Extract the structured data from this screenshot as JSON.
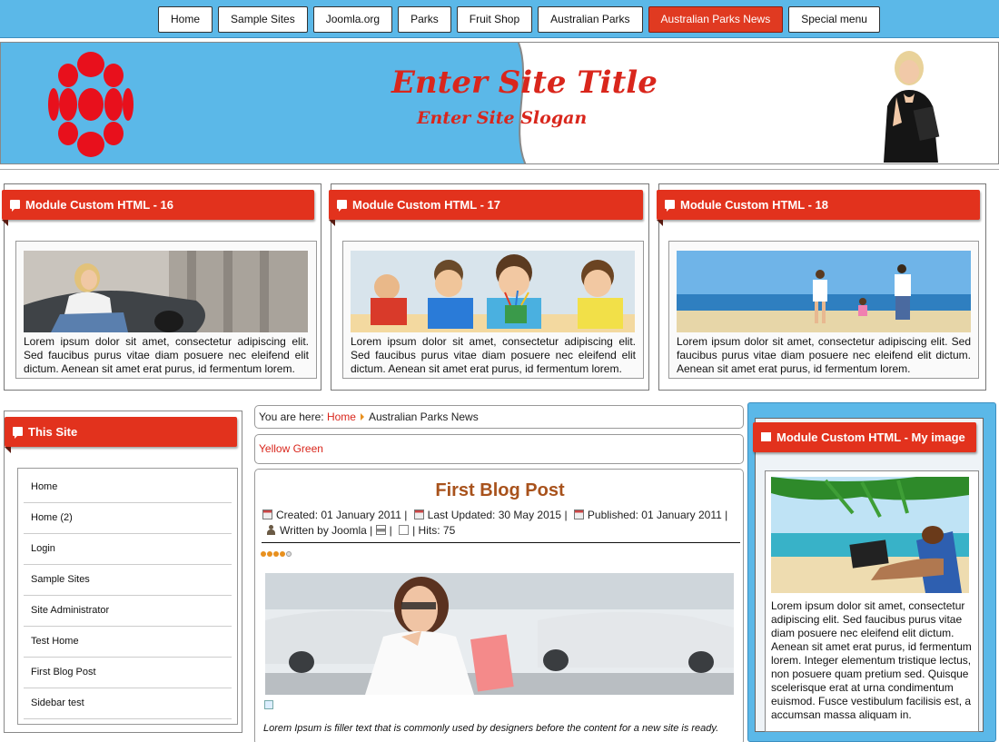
{
  "nav": {
    "items": [
      {
        "label": "Home",
        "active": false
      },
      {
        "label": "Sample Sites",
        "active": false
      },
      {
        "label": "Joomla.org",
        "active": false
      },
      {
        "label": "Parks",
        "active": false
      },
      {
        "label": "Fruit Shop",
        "active": false
      },
      {
        "label": "Australian Parks",
        "active": false
      },
      {
        "label": "Australian Parks News",
        "active": true
      },
      {
        "label": "Special menu",
        "active": false
      }
    ]
  },
  "header": {
    "title": "Enter Site Title",
    "slogan": "Enter Site Slogan"
  },
  "modules": [
    {
      "title": "Module Custom HTML - 16",
      "text": "Lorem ipsum dolor sit amet, consectetur adipiscing elit. Sed faucibus purus vitae diam posuere nec eleifend elit dictum. Aenean sit amet erat purus, id fermentum lorem.",
      "image": "woman-with-car-photo"
    },
    {
      "title": "Module Custom HTML - 17",
      "text": "Lorem ipsum dolor sit amet, consectetur adipiscing elit. Sed faucibus purus vitae diam posuere nec eleifend elit dictum. Aenean sit amet erat purus, id fermentum lorem.",
      "image": "children-classroom-photo"
    },
    {
      "title": "Module Custom HTML - 18",
      "text": "Lorem ipsum dolor sit amet, consectetur adipiscing elit. Sed faucibus purus vitae diam posuere nec eleifend elit dictum. Aenean sit amet erat purus, id fermentum lorem.",
      "image": "family-beach-photo"
    }
  ],
  "sidebar": {
    "title": "This Site",
    "links": [
      "Home",
      "Home (2)",
      "Login",
      "Sample Sites",
      "Site Administrator",
      "Test Home",
      "First Blog Post",
      "Sidebar test"
    ]
  },
  "breadcrumb": {
    "prefix": "You are here:",
    "home": "Home",
    "current": "Australian Parks News"
  },
  "yellow_green": "Yellow Green",
  "article": {
    "title": "First Blog Post",
    "created": "Created: 01 January 2011 |",
    "updated": "Last Updated: 30 May 2015 |",
    "published": "Published: 01 January 2011 |",
    "written": "Written",
    "author": "by Joomla |",
    "sep": "|",
    "hits": "| Hits: 75",
    "rating": 4,
    "rating_max": 5,
    "intro": "Lorem Ipsum is filler text that is commonly used by designers before the content for a new site is ready."
  },
  "right": {
    "title": "Module Custom HTML - My image",
    "text": "Lorem ipsum dolor sit amet, consectetur adipiscing elit. Sed faucibus purus vitae diam posuere nec eleifend elit dictum. Aenean sit amet erat purus, id fermentum lorem. Integer elementum tristique lectus, non posuere quam pretium sed. Quisque scelerisque erat at urna condimentum euismod. Fusce vestibulum facilisis est, a accumsan massa aliquam in."
  },
  "colors": {
    "accent_red": "#e2321d",
    "sky_blue": "#5bb8e8",
    "title_brown": "#a8521c"
  }
}
